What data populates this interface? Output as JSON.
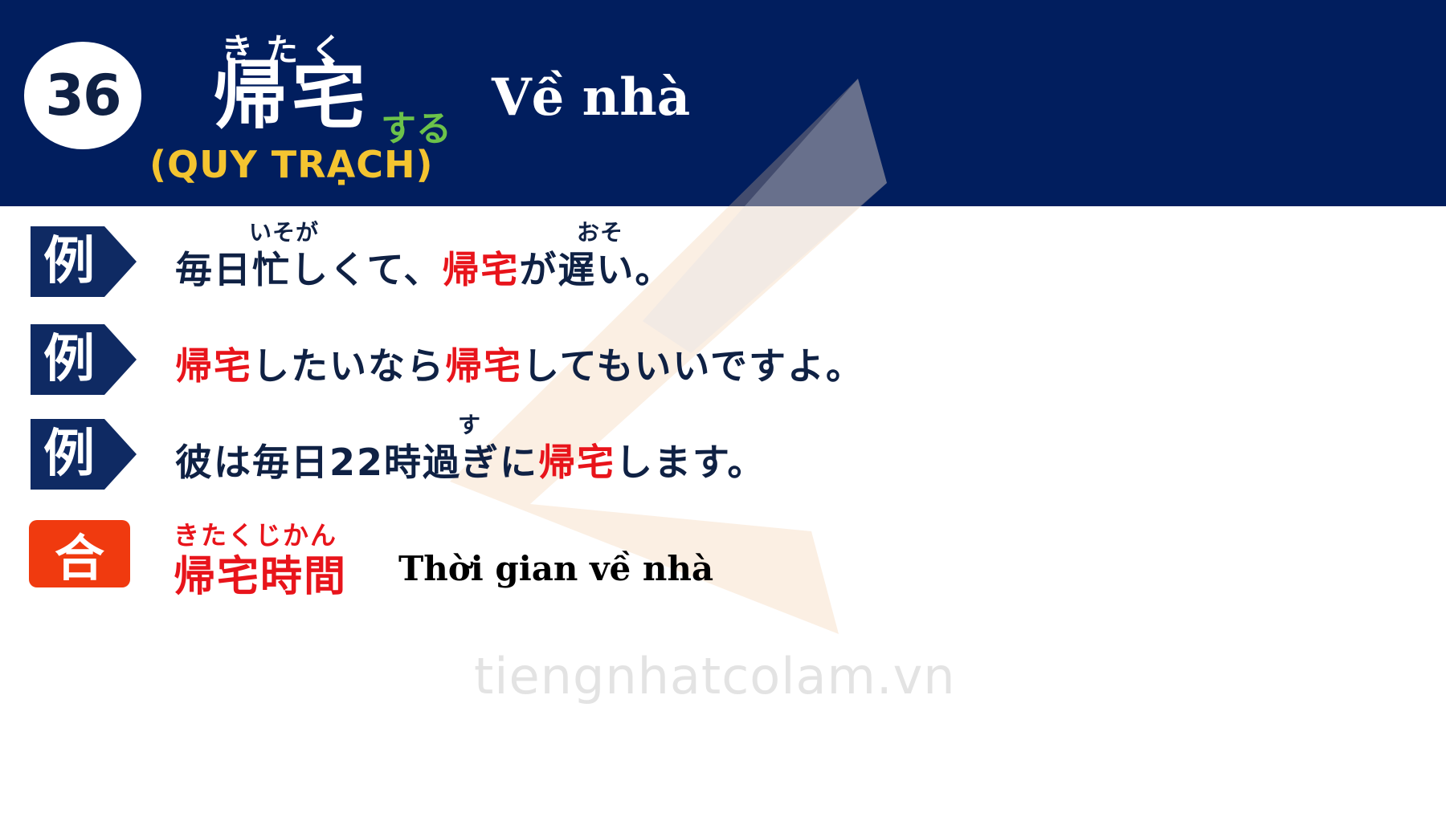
{
  "header": {
    "number": "36",
    "furigana": "きたく",
    "kanji": "帰宅",
    "suffix": "する",
    "hanviet": "(QUY TRẠCH)",
    "meaning": "Về nhà"
  },
  "examples": [
    {
      "tag": "例",
      "ruby": [
        "いそが",
        "おそ"
      ],
      "parts": [
        "毎日忙しくて、",
        "帰宅",
        "が遅い。"
      ]
    },
    {
      "tag": "例",
      "parts": [
        "帰宅",
        "したいなら",
        "帰宅",
        "してもいいですよ。"
      ]
    },
    {
      "tag": "例",
      "ruby": [
        "す"
      ],
      "parts": [
        "彼は毎日22時過ぎに",
        "帰宅",
        "します。"
      ]
    }
  ],
  "compound": {
    "tag": "合",
    "furigana": "きたくじかん",
    "word": "帰宅時間",
    "meaning": "Thời gian về nhà"
  },
  "watermark": "tiengnhatcolam.vn",
  "colors": {
    "header_bg": "#011e5e",
    "accent_red": "#e8141b",
    "hanviet_gold": "#f4c430",
    "suru_green": "#6cc24a",
    "compound_tag_bg": "#f03a0f"
  }
}
